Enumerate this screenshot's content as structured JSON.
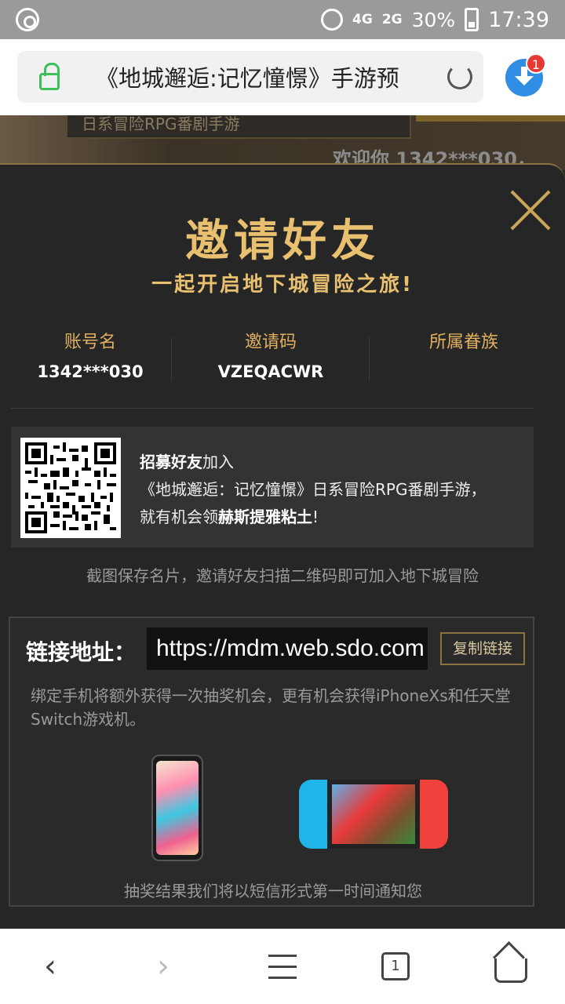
{
  "status_bar": {
    "network": "4G",
    "network2": "2G",
    "battery": "30%",
    "time": "17:39"
  },
  "browser": {
    "url_title": "《地城邂逅:记忆憧憬》手游预",
    "download_badge": "1"
  },
  "background": {
    "banner_text": "日系冒险RPG番剧手游",
    "welcome": "欢迎你 1342***030，"
  },
  "modal": {
    "title": "邀请好友",
    "subtitle": "一起开启地下城冒险之旅!",
    "account_label": "账号名",
    "account_value": "1342***030",
    "invite_label": "邀请码",
    "invite_value": "VZEQACWR",
    "family_label": "所属眷族",
    "family_value": "",
    "qr_line1_bold": "招募好友",
    "qr_line1_rest": "加入",
    "qr_line2": "《地城邂逅：记忆憧憬》日系冒险RPG番剧手游，",
    "qr_line3_a": "就有机会领",
    "qr_line3_bold": "赫斯提雅粘土",
    "qr_line3_b": "!",
    "hint": "截图保存名片，邀请好友扫描二维码即可加入地下城冒险",
    "link_label": "链接地址：",
    "link_value": "https://mdm.web.sdo.com",
    "copy_button": "复制链接",
    "desc": "绑定手机将额外获得一次抽奖机会，更有机会获得iPhoneXs和任天堂Switch游戏机。",
    "result_note": "抽奖结果我们将以短信形式第一时间通知您"
  },
  "nav": {
    "back": "‹",
    "forward": "›",
    "tabs_count": "1"
  },
  "colors": {
    "gold": "#e8c070",
    "modal_bg": "#262626",
    "link_accent": "#2f8de4"
  }
}
